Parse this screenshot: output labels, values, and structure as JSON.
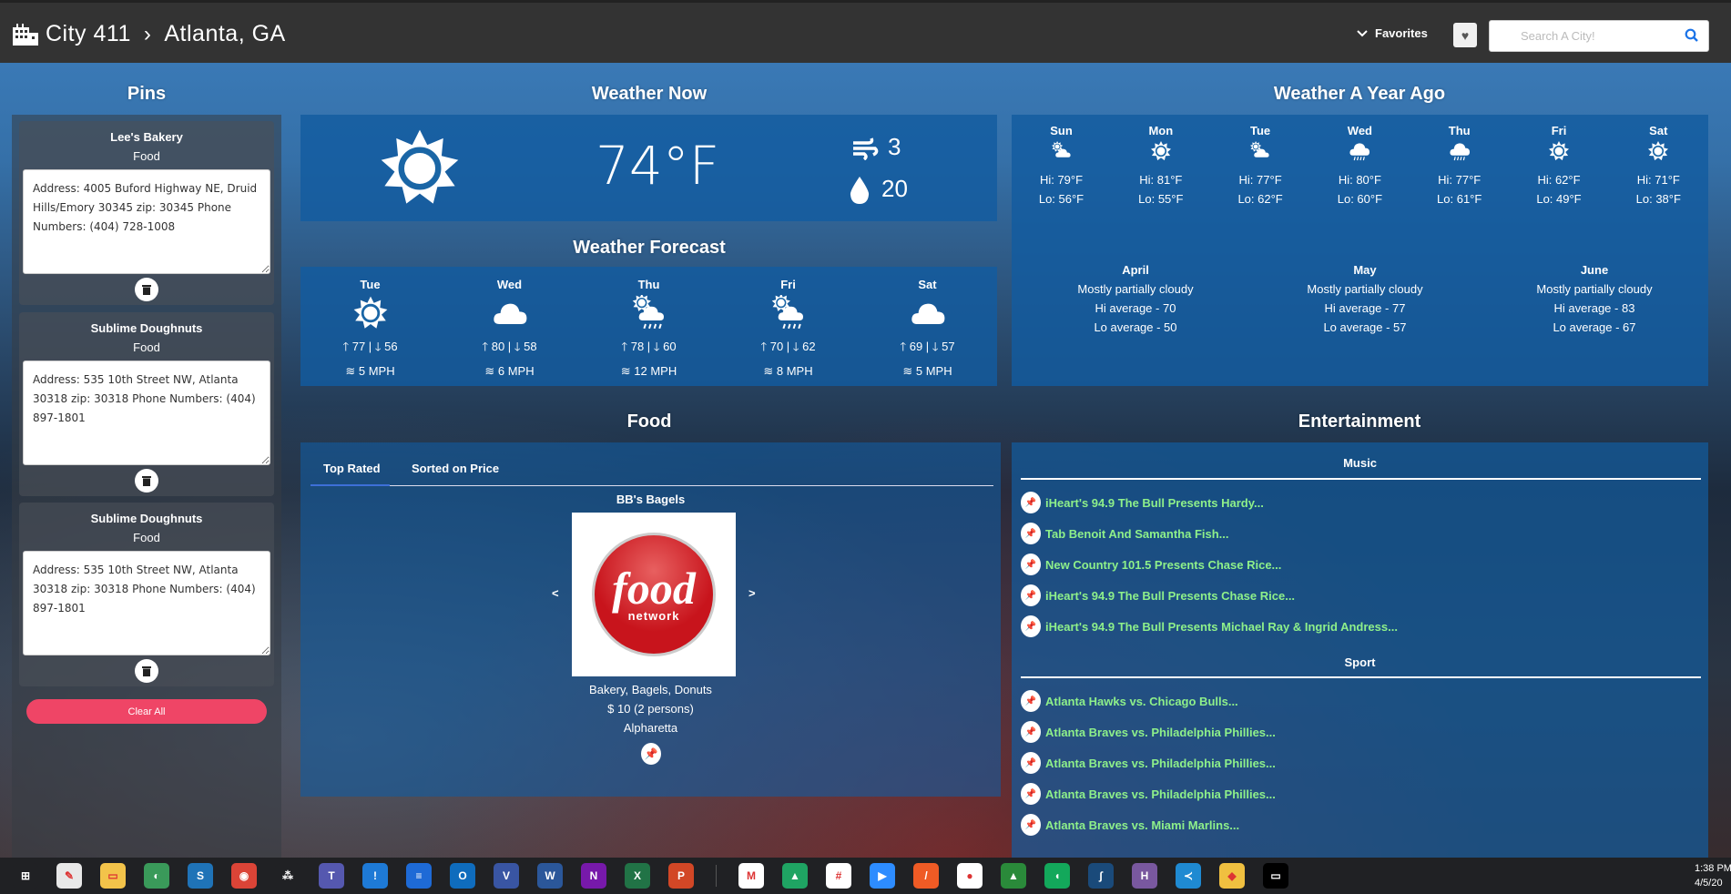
{
  "header": {
    "app_name": "City 411",
    "city": "Atlanta, GA",
    "favorites_label": "Favorites",
    "search_placeholder": "Search A City!"
  },
  "pins": {
    "title": "Pins",
    "clear_label": "Clear All",
    "items": [
      {
        "name": "Lee's Bakery",
        "category": "Food",
        "details": "Address: 4005 Buford Highway NE, Druid Hills/Emory 30345 zip: 30345 Phone Numbers: (404) 728-1008"
      },
      {
        "name": "Sublime Doughnuts",
        "category": "Food",
        "details": "Address: 535 10th Street NW, Atlanta 30318 zip: 30318 Phone Numbers: (404) 897-1801"
      },
      {
        "name": "Sublime Doughnuts",
        "category": "Food",
        "details": "Address: 535 10th Street NW, Atlanta 30318 zip: 30318 Phone Numbers: (404) 897-1801"
      }
    ]
  },
  "weather_now": {
    "title": "Weather Now",
    "icon": "sun-icon",
    "temp": "74°F",
    "wind": "3",
    "humidity": "20"
  },
  "forecast": {
    "title": "Weather Forecast",
    "days": [
      {
        "day": "Tue",
        "icon": "sun",
        "hi": "77",
        "lo": "56",
        "wind": "5 MPH"
      },
      {
        "day": "Wed",
        "icon": "cloud",
        "hi": "80",
        "lo": "58",
        "wind": "6 MPH"
      },
      {
        "day": "Thu",
        "icon": "partly-rain",
        "hi": "78",
        "lo": "60",
        "wind": "12 MPH"
      },
      {
        "day": "Fri",
        "icon": "partly-rain",
        "hi": "70",
        "lo": "62",
        "wind": "8 MPH"
      },
      {
        "day": "Sat",
        "icon": "cloud",
        "hi": "69",
        "lo": "57",
        "wind": "5 MPH"
      }
    ]
  },
  "year_ago": {
    "title": "Weather A Year Ago",
    "days": [
      {
        "day": "Sun",
        "icon": "partly-cloudy",
        "hi": "Hi: 79°F",
        "lo": "Lo: 56°F"
      },
      {
        "day": "Mon",
        "icon": "sun",
        "hi": "Hi: 81°F",
        "lo": "Lo: 55°F"
      },
      {
        "day": "Tue",
        "icon": "partly-cloudy",
        "hi": "Hi: 77°F",
        "lo": "Lo: 62°F"
      },
      {
        "day": "Wed",
        "icon": "rain",
        "hi": "Hi: 80°F",
        "lo": "Lo: 60°F"
      },
      {
        "day": "Thu",
        "icon": "rain",
        "hi": "Hi: 77°F",
        "lo": "Lo: 61°F"
      },
      {
        "day": "Fri",
        "icon": "sun",
        "hi": "Hi: 62°F",
        "lo": "Lo: 49°F"
      },
      {
        "day": "Sat",
        "icon": "sun",
        "hi": "Hi: 71°F",
        "lo": "Lo: 38°F"
      }
    ],
    "months": [
      {
        "name": "April",
        "desc": "Mostly partially cloudy",
        "hi": "Hi average - 70",
        "lo": "Lo average - 50"
      },
      {
        "name": "May",
        "desc": "Mostly partially cloudy",
        "hi": "Hi average - 77",
        "lo": "Lo average - 57"
      },
      {
        "name": "June",
        "desc": "Mostly partially cloudy",
        "hi": "Hi average - 83",
        "lo": "Lo average - 67"
      }
    ]
  },
  "food": {
    "title": "Food",
    "tabs": [
      "Top Rated",
      "Sorted on Price"
    ],
    "active_tab": "Top Rated",
    "restaurant": {
      "name": "BB's Bagels",
      "logo_text": "food",
      "logo_sub": "network",
      "cuisine": "Bakery, Bagels, Donuts",
      "price": "$ 10 (2 persons)",
      "location": "Alpharetta"
    },
    "prev": "<",
    "next": ">"
  },
  "entertainment": {
    "title": "Entertainment",
    "music_label": "Music",
    "sport_label": "Sport",
    "music": [
      "iHeart's 94.9 The Bull Presents Hardy...",
      "Tab Benoit And Samantha Fish...",
      "New Country 101.5 Presents Chase Rice...",
      "iHeart's 94.9 The Bull Presents Chase Rice...",
      "iHeart's 94.9 The Bull Presents Michael Ray & Ingrid Andress..."
    ],
    "sport": [
      "Atlanta Hawks vs. Chicago Bulls...",
      "Atlanta Braves vs. Philadelphia Phillies...",
      "Atlanta Braves vs. Philadelphia Phillies...",
      "Atlanta Braves vs. Philadelphia Phillies...",
      "Atlanta Braves vs. Miami Marlins..."
    ],
    "link_color": "#8ef08a"
  },
  "taskbar": {
    "time": "1:38 PM",
    "date": "4/5/20",
    "apps": [
      {
        "name": "start",
        "c": "#202124",
        "g": "⊞"
      },
      {
        "name": "paint",
        "c": "#e8e8e8",
        "g": "✎"
      },
      {
        "name": "file-explorer",
        "c": "#f3c34a",
        "g": "▭"
      },
      {
        "name": "globe-app",
        "c": "#3a9a5a",
        "g": "◐"
      },
      {
        "name": "s-app",
        "c": "#1f73b7",
        "g": "S"
      },
      {
        "name": "chrome",
        "c": "#db4437",
        "g": "◉"
      },
      {
        "name": "asana",
        "c": "#202124",
        "g": "⁂"
      },
      {
        "name": "teams",
        "c": "#5558af",
        "g": "T"
      },
      {
        "name": "alert-app",
        "c": "#1e7ad6",
        "g": "!"
      },
      {
        "name": "devops",
        "c": "#1e6ad6",
        "g": "≡"
      },
      {
        "name": "outlook",
        "c": "#0f6cbd",
        "g": "O"
      },
      {
        "name": "visio",
        "c": "#3955a3",
        "g": "V"
      },
      {
        "name": "word",
        "c": "#2b579a",
        "g": "W"
      },
      {
        "name": "onenote",
        "c": "#7719aa",
        "g": "N"
      },
      {
        "name": "excel",
        "c": "#217346",
        "g": "X"
      },
      {
        "name": "powerpoint",
        "c": "#d24726",
        "g": "P"
      },
      {
        "name": "gmail",
        "c": "#ffffff",
        "g": "M"
      },
      {
        "name": "google-drive",
        "c": "#1fa463",
        "g": "▲"
      },
      {
        "name": "slack",
        "c": "#ffffff",
        "g": "#"
      },
      {
        "name": "zoom",
        "c": "#2d8cff",
        "g": "▶"
      },
      {
        "name": "postman",
        "c": "#ef5b25",
        "g": "/"
      },
      {
        "name": "mongodb",
        "c": "#ffffff",
        "g": "●"
      },
      {
        "name": "rocket-app",
        "c": "#2a8a3a",
        "g": "▲"
      },
      {
        "name": "green-app",
        "c": "#13a85b",
        "g": "◖"
      },
      {
        "name": "wireshark",
        "c": "#1a4a7a",
        "g": "∫"
      },
      {
        "name": "heroku",
        "c": "#79589f",
        "g": "H"
      },
      {
        "name": "vscode",
        "c": "#1f8ad2",
        "g": "≺"
      },
      {
        "name": "git",
        "c": "#f0c040",
        "g": "◆"
      },
      {
        "name": "terminal",
        "c": "#000000",
        "g": "▭"
      }
    ]
  }
}
